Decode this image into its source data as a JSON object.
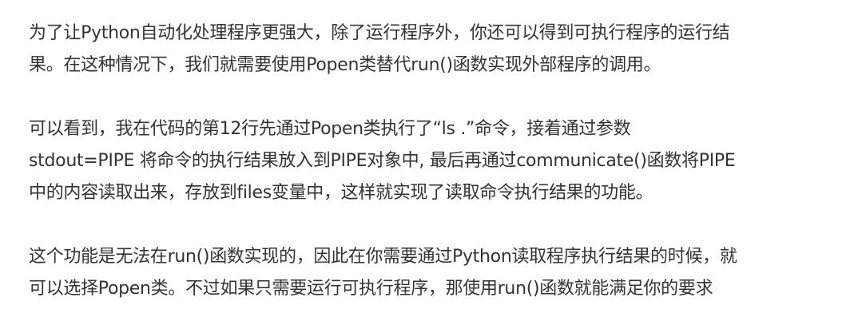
{
  "article": {
    "paragraphs": [
      {
        "lines": [
          "为了让Python自动化处理程序更强大，除了运行程序外，你还可以得到可执行程序的运行结",
          "果。在这种情况下，我们就需要使用Popen类替代run()函数实现外部程序的调用。"
        ]
      },
      {
        "lines": [
          "可以看到，我在代码的第12行先通过Popen类执行了“ls .”命令，接着通过参数",
          "stdout=PIPE 将命令的执行结果放入到PIPE对象中, 最后再通过communicate()函数将PIPE",
          "中的内容读取出来，存放到files变量中，这样就实现了读取命令执行结果的功能。"
        ]
      },
      {
        "lines": [
          "这个功能是无法在run()函数实现的，因此在你需要通过Python读取程序执行结果的时候，就",
          "可以选择Popen类。不过如果只需要运行可执行程序，那使用run()函数就能满足你的要求"
        ]
      }
    ]
  }
}
